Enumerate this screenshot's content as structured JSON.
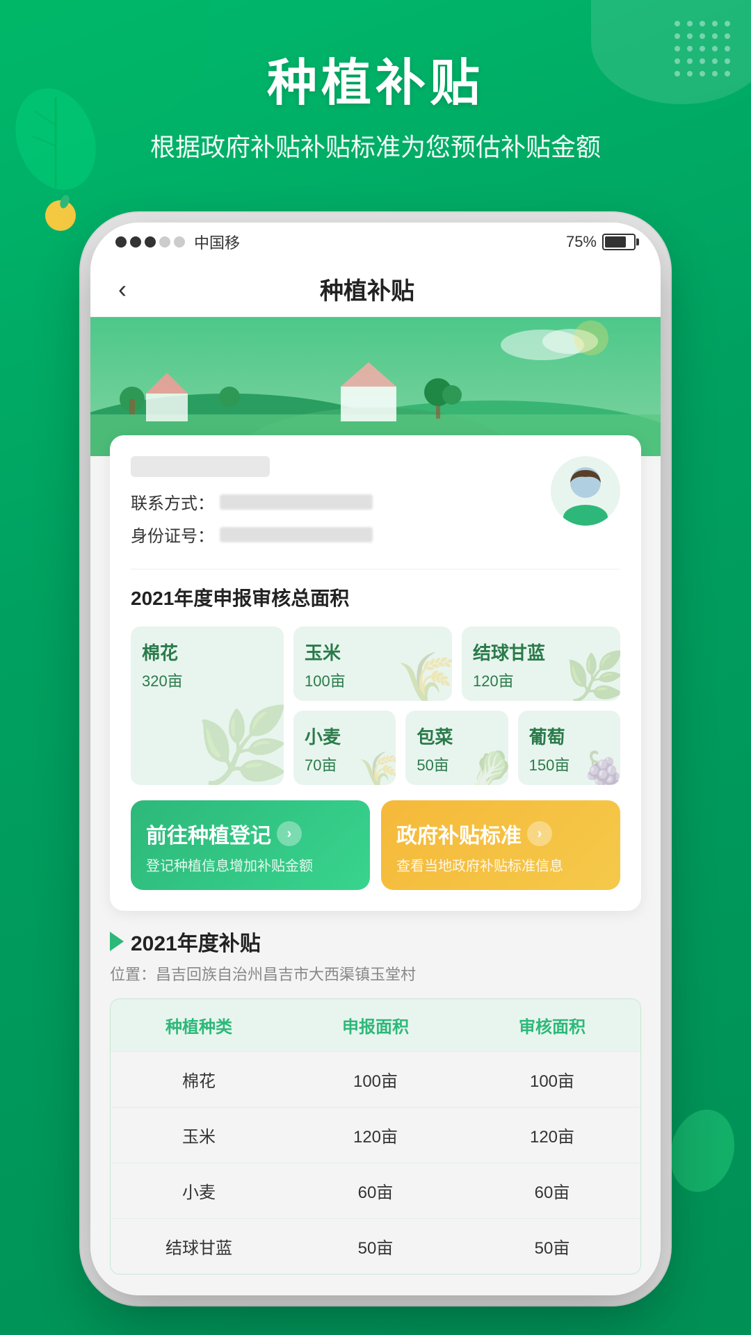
{
  "background": {
    "color": "#00b96b"
  },
  "header": {
    "main_title": "种植补贴",
    "sub_title": "根据政府补贴补贴标准为您预估补贴金额"
  },
  "status_bar": {
    "signal": "●●●○○",
    "carrier": "中国移",
    "battery_pct": "75%"
  },
  "nav": {
    "back": "‹",
    "title": "种植补贴"
  },
  "profile": {
    "contact_label": "联系方式：",
    "id_label": "身份证号："
  },
  "crops_section": {
    "title": "2021年度申报审核总面积",
    "crops": [
      {
        "name": "棉花",
        "area": "320亩",
        "large": true
      },
      {
        "name": "玉米",
        "area": "100亩",
        "large": false
      },
      {
        "name": "结球甘蓝",
        "area": "120亩",
        "large": false
      },
      {
        "name": "小麦",
        "area": "70亩",
        "large": false
      },
      {
        "name": "包菜",
        "area": "50亩",
        "large": false
      },
      {
        "name": "葡萄",
        "area": "150亩",
        "large": false
      }
    ]
  },
  "action_buttons": [
    {
      "title": "前往种植登记",
      "desc": "登记种植信息增加补贴金额",
      "type": "green"
    },
    {
      "title": "政府补贴标准",
      "desc": "查看当地政府补贴标准信息",
      "type": "orange"
    }
  ],
  "subsidy_section": {
    "title": "2021年度补贴",
    "location": "位置：昌吉回族自治州昌吉市大西渠镇玉堂村",
    "table_headers": [
      "种植种类",
      "申报面积",
      "审核面积"
    ],
    "table_rows": [
      {
        "type": "棉花",
        "reported": "100亩",
        "approved": "100亩"
      },
      {
        "type": "玉米",
        "reported": "120亩",
        "approved": "120亩"
      },
      {
        "type": "小麦",
        "reported": "60亩",
        "approved": "60亩"
      },
      {
        "type": "结球甘蓝",
        "reported": "50亩",
        "approved": "50亩"
      }
    ]
  }
}
